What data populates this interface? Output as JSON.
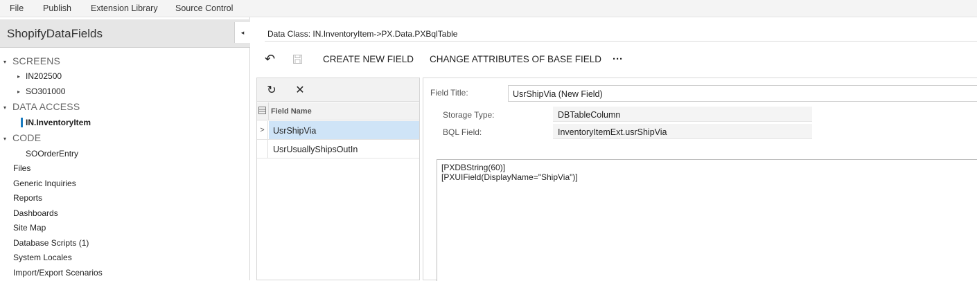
{
  "menu": {
    "items": [
      "File",
      "Publish",
      "Extension Library",
      "Source Control"
    ]
  },
  "sidebar": {
    "project_title": "ShopifyDataFields",
    "collapse_glyph": "◂",
    "tree": {
      "screens": {
        "label": "SCREENS",
        "children": [
          "IN202500",
          "SO301000"
        ]
      },
      "data_access": {
        "label": "DATA ACCESS",
        "children": [
          "IN.InventoryItem"
        ]
      },
      "code": {
        "label": "CODE",
        "children": [
          "SOOrderEntry"
        ]
      },
      "others": [
        "Files",
        "Generic Inquiries",
        "Reports",
        "Dashboards",
        "Site Map",
        "Database Scripts (1)",
        "System Locales",
        "Import/Export Scenarios"
      ]
    }
  },
  "main": {
    "data_class": "Data Class: IN.InventoryItem->PX.Data.PXBqlTable",
    "toolbar": {
      "undo_icon": "↶",
      "save_icon": "save-icon",
      "create_new_field": "CREATE NEW FIELD",
      "change_attributes": "CHANGE ATTRIBUTES OF BASE FIELD",
      "more": "···"
    },
    "grid": {
      "refresh_icon": "↻",
      "delete_icon": "✕",
      "header_field_name": "Field Name",
      "rows": [
        {
          "name": "UsrShipVia",
          "selected": true
        },
        {
          "name": "UsrUsuallyShipsOutIn",
          "selected": false
        }
      ]
    },
    "form": {
      "field_title_label": "Field Title:",
      "field_title_value": "UsrShipVia (New Field)",
      "storage_type_label": "Storage Type:",
      "storage_type_value": "DBTableColumn",
      "bql_field_label": "BQL Field:",
      "bql_field_value": "InventoryItemExt.usrShipVia",
      "code_lines": [
        "[PXDBString(60)]",
        "[PXUIField(DisplayName=\"ShipVia\")]"
      ]
    }
  },
  "colors": {
    "accent": "#1a7cc0",
    "selected_row": "#cfe4f7",
    "header_bg": "#e6e6e6"
  }
}
